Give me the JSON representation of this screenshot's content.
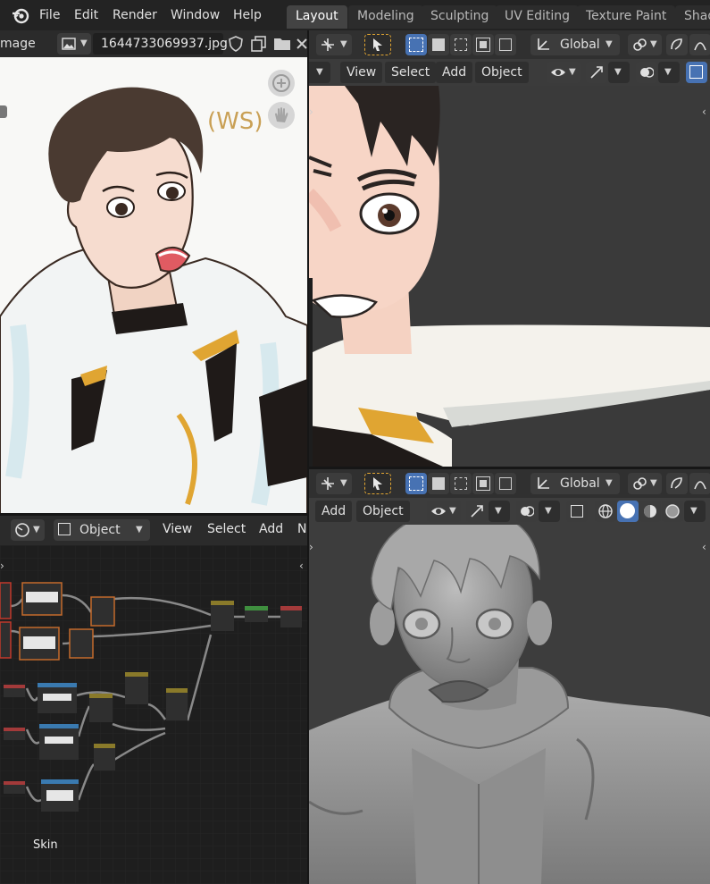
{
  "app": {
    "name": "Blender"
  },
  "top_menu": [
    "File",
    "Edit",
    "Render",
    "Window",
    "Help"
  ],
  "workspace_tabs": [
    {
      "label": "Layout",
      "active": true
    },
    {
      "label": "Modeling",
      "active": false
    },
    {
      "label": "Sculpting",
      "active": false
    },
    {
      "label": "UV Editing",
      "active": false
    },
    {
      "label": "Texture Paint",
      "active": false
    },
    {
      "label": "Shad",
      "active": false
    }
  ],
  "image_editor": {
    "mode_label": "mage",
    "filename": "1644733069937.jpg",
    "sketch_text": "(WS)"
  },
  "viewport_top": {
    "orientation": "Global",
    "menus": [
      "View",
      "Select",
      "Add",
      "Object"
    ]
  },
  "node_editor": {
    "mode": "Object",
    "menus": [
      "View",
      "Select",
      "Add",
      "N"
    ],
    "frame_label": "Skin"
  },
  "viewport_bottom": {
    "orientation": "Global",
    "menus": [
      "Add",
      "Object"
    ]
  },
  "colors": {
    "accent": "#4772b3",
    "active_tab": "#434343",
    "header": "#2b2b2b",
    "background": "#1d1d1d"
  },
  "icons": [
    "blender-logo-icon",
    "image-icon",
    "shield-icon",
    "duplicate-icon",
    "folder-icon",
    "close-icon",
    "zoom-icon",
    "hand-icon",
    "transform-pivot-icon",
    "select-cursor-icon",
    "select-box-icon",
    "global-axis-icon",
    "snap-icon",
    "proportional-icon",
    "eye-icon",
    "gizmo-icon",
    "overlay-icon",
    "xray-icon",
    "wireframe-icon",
    "solid-icon",
    "material-icon",
    "rendered-icon",
    "editor-type-icon"
  ]
}
